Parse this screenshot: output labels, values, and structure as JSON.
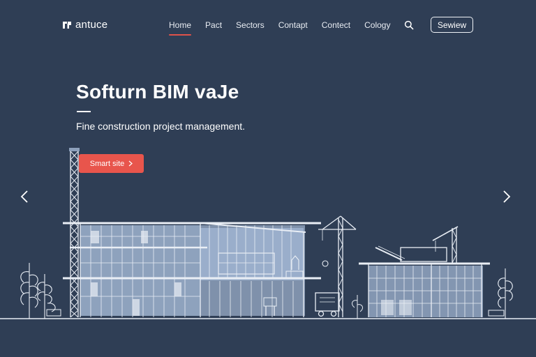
{
  "brand": {
    "name": "antuce",
    "icon": "brand-mark-icon"
  },
  "nav": {
    "links": [
      {
        "label": "Home",
        "active": true
      },
      {
        "label": "Pact",
        "active": false
      },
      {
        "label": "Sectors",
        "active": false
      },
      {
        "label": "Contapt",
        "active": false
      },
      {
        "label": "Contect",
        "active": false
      },
      {
        "label": "Cology",
        "active": false
      }
    ],
    "search_icon": "search-icon",
    "cta_label": "Sewiew"
  },
  "hero": {
    "title": "Softurn BIM vaJe",
    "subtitle": "Fine construction project management.",
    "button_label": "Smart site",
    "button_icon": "chevron-right-icon"
  },
  "carousel": {
    "prev_icon": "chevron-left-icon",
    "next_icon": "chevron-right-icon"
  },
  "colors": {
    "background": "#2f3e55",
    "accent": "#e8554c",
    "text": "#ffffff",
    "glass": "#8da0bb"
  }
}
